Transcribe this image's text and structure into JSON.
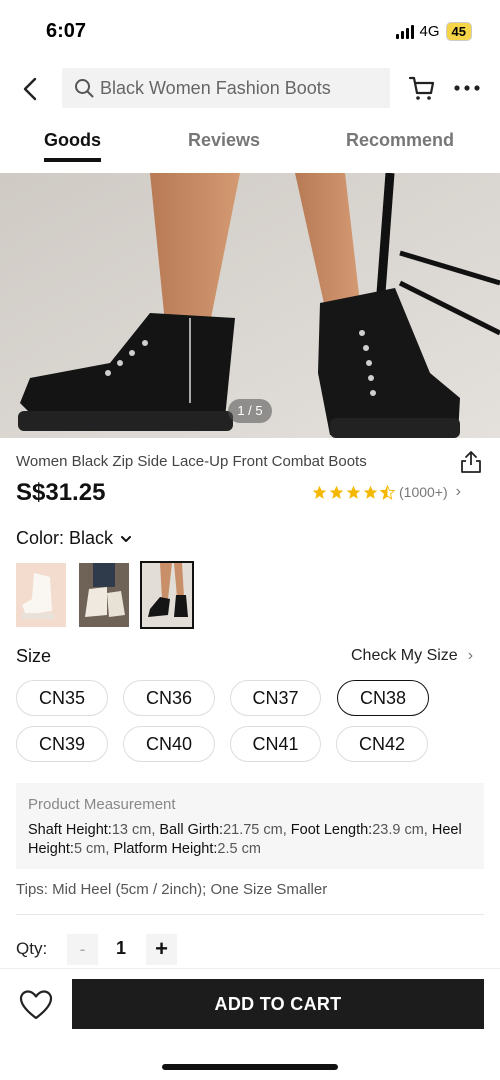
{
  "status": {
    "time": "6:07",
    "network": "4G",
    "battery": "45"
  },
  "header": {
    "search_placeholder": "Black Women Fashion Boots"
  },
  "tabs": [
    {
      "label": "Goods",
      "active": true
    },
    {
      "label": "Reviews",
      "active": false
    },
    {
      "label": "Recommend",
      "active": false
    }
  ],
  "gallery": {
    "pager": "1 / 5"
  },
  "product": {
    "title": "Women Black Zip Side Lace-Up Front Combat Boots",
    "price": "S$31.25",
    "rating": 4.5,
    "review_count": "(1000+)"
  },
  "color": {
    "label": "Color: Black",
    "swatches": [
      {
        "name": "white",
        "selected": false
      },
      {
        "name": "beige",
        "selected": false
      },
      {
        "name": "black",
        "selected": true
      }
    ]
  },
  "size": {
    "label": "Size",
    "check_label": "Check My Size",
    "options": [
      {
        "label": "CN35",
        "selected": false
      },
      {
        "label": "CN36",
        "selected": false
      },
      {
        "label": "CN37",
        "selected": false
      },
      {
        "label": "CN38",
        "selected": true
      },
      {
        "label": "CN39",
        "selected": false
      },
      {
        "label": "CN40",
        "selected": false
      },
      {
        "label": "CN41",
        "selected": false
      },
      {
        "label": "CN42",
        "selected": false
      }
    ]
  },
  "measurement": {
    "heading": "Product Measurement",
    "items": [
      {
        "key": "Shaft Height:",
        "value": "13 cm"
      },
      {
        "key": "Ball Girth:",
        "value": "21.75 cm"
      },
      {
        "key": "Foot Length:",
        "value": "23.9 cm"
      },
      {
        "key": "Heel Height:",
        "value": "5 cm"
      },
      {
        "key": "Platform Height:",
        "value": "2.5 cm"
      }
    ]
  },
  "tips": "Tips: Mid Heel (5cm / 2inch); One Size Smaller",
  "quantity": {
    "label": "Qty:",
    "minus": "-",
    "value": "1",
    "plus": "+"
  },
  "actions": {
    "add_to_cart": "ADD TO CART"
  },
  "colors": {
    "star": "#f5b800",
    "button": "#1c1c1c"
  }
}
